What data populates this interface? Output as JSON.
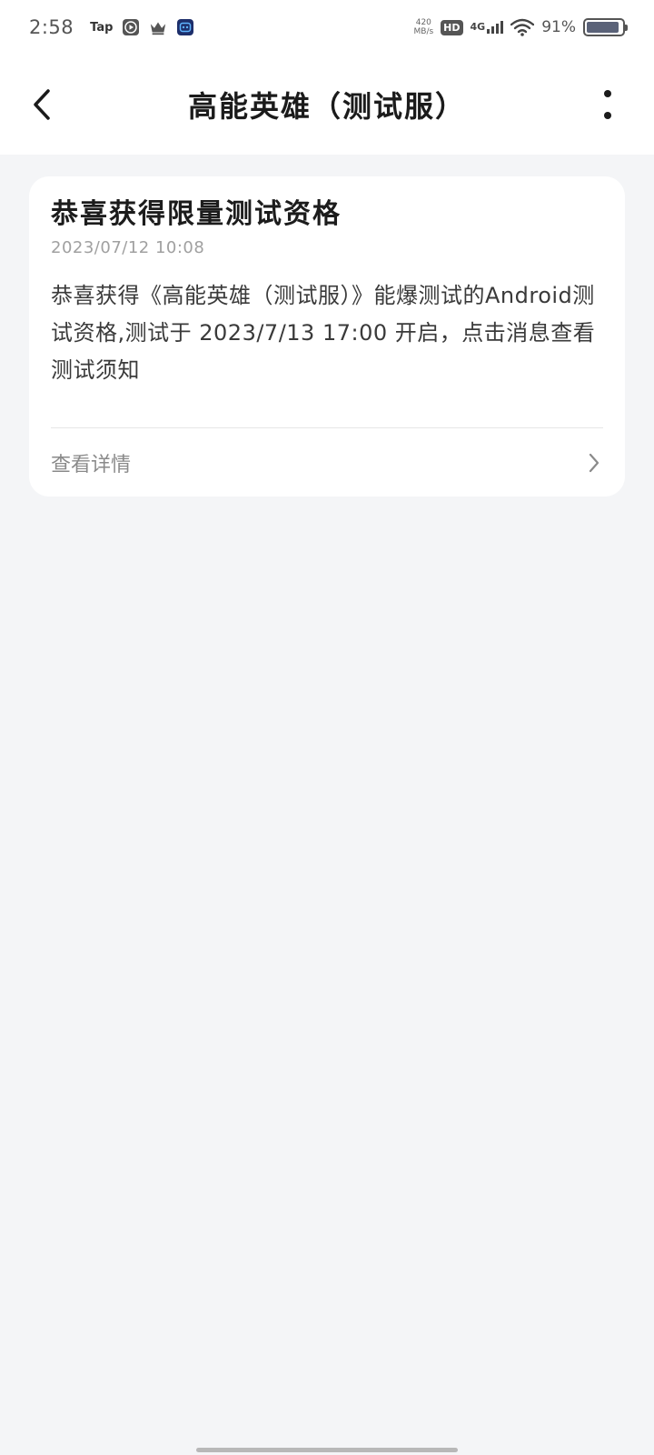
{
  "status_bar": {
    "time": "2:58",
    "tap_label": "Tap",
    "net_speed_value": "420",
    "net_speed_unit": "MB/s",
    "hd_label": "HD",
    "network_label": "4G",
    "battery_percent": "91%",
    "battery_level": 0.91
  },
  "header": {
    "title": "高能英雄（测试服）"
  },
  "message": {
    "title": "恭喜获得限量测试资格",
    "timestamp": "2023/07/12 10:08",
    "body": "恭喜获得《高能英雄（测试服）》能爆测试的Android测试资格,测试于 2023/7/13 17:00 开启，点击消息查看测试须知",
    "action_label": "查看详情"
  }
}
